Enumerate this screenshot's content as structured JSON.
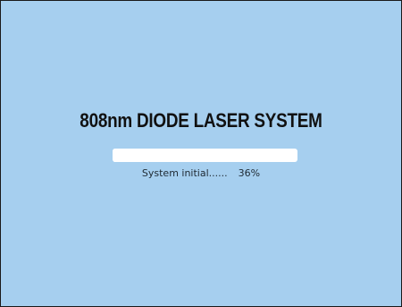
{
  "title": "808nm DIODE LASER SYSTEM",
  "progress": {
    "status_label": "System initial......",
    "percent_text": "36%",
    "value": 0.36
  },
  "colors": {
    "background": "#a6cfef",
    "bar_track": "#ffffff",
    "title_text": "#111111"
  }
}
